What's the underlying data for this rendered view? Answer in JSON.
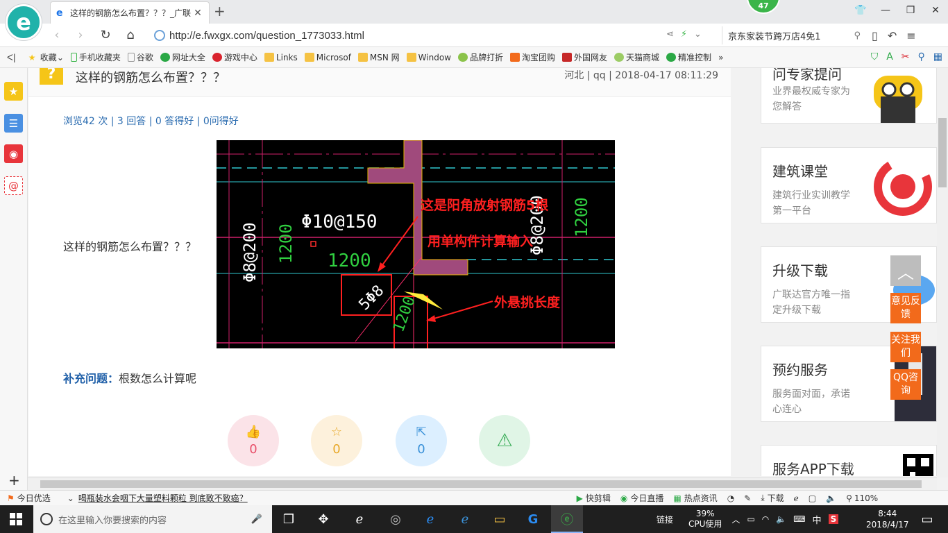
{
  "browser": {
    "tab_title": "这样的钢筋怎么布置？？？_广联",
    "notification_count": "47",
    "url": "http://e.fwxgx.com/question_1773033.html",
    "search_text": "京东家装节跨万店4免1"
  },
  "favorites": [
    {
      "label": "收藏"
    },
    {
      "label": "手机收藏夹"
    },
    {
      "label": "谷歌"
    },
    {
      "label": "网址大全"
    },
    {
      "label": "游戏中心"
    },
    {
      "label": "Links"
    },
    {
      "label": "Microsof"
    },
    {
      "label": "MSN 网"
    },
    {
      "label": "Window"
    },
    {
      "label": "品牌打折"
    },
    {
      "label": "淘宝团购"
    },
    {
      "label": "外国网友"
    },
    {
      "label": "天猫商城"
    },
    {
      "label": "精准控制"
    }
  ],
  "question": {
    "title": "这样的钢筋怎么布置？？？",
    "meta": "河北 | qq | 2018-04-17 08:11:29",
    "stats": "浏览42 次 | 3 回答 | 0 答得好 | 0问得好",
    "body": "这样的钢筋怎么布置？？？",
    "supplement_label": "补充问题：",
    "supplement_text": "根数怎么计算呢"
  },
  "cad": {
    "annotation_1": "这是阳角放射钢筋5根",
    "annotation_2": "用单构件计算输入",
    "annotation_3": "外悬挑长度",
    "text_rebar_left": "Φ8@200",
    "text_rebar_top": "Φ10@150",
    "text_dim_1200": "1200",
    "text_5phi8": "5Φ8",
    "text_rebar_right": "Φ8@200"
  },
  "actions": [
    {
      "count": "0",
      "color": "#e8506a",
      "bg": "#fbe3e8"
    },
    {
      "count": "0",
      "color": "#e8a92a",
      "bg": "#fdf1dc"
    },
    {
      "count": "0",
      "color": "#3b92d9",
      "bg": "#dcefff"
    },
    {
      "count": "",
      "color": "#3cae5a",
      "bg": "#e0f5e6"
    }
  ],
  "sidebar_cards": [
    {
      "title": "问专家提问",
      "desc": "业界最权威专家为您解答"
    },
    {
      "title": "建筑课堂",
      "desc": "建筑行业实训教学第一平台"
    },
    {
      "title": "升级下载",
      "desc": "广联达官方唯一指定升级下载"
    },
    {
      "title": "预约服务",
      "desc": "服务面对面，承诺心连心"
    },
    {
      "title": "服务APP下载",
      "desc": ""
    }
  ],
  "float_buttons": {
    "feedback": "意见反馈",
    "follow": "关注我们",
    "qq": "QQ咨询"
  },
  "statusbar": {
    "today_pick": "今日优选",
    "news": "喝瓶装水会咽下大量塑料颗粒 到底致不致癌？",
    "quick_edit": "快剪辑",
    "live": "今日直播",
    "hot_news": "热点资讯",
    "download": "下载",
    "zoom": "110%"
  },
  "taskbar": {
    "search_placeholder": "在这里输入你要搜索的内容",
    "link_label": "链接",
    "cpu_percent": "39%",
    "cpu_label": "CPU使用",
    "ime": "中",
    "time": "8:44",
    "date": "2018/4/17"
  }
}
